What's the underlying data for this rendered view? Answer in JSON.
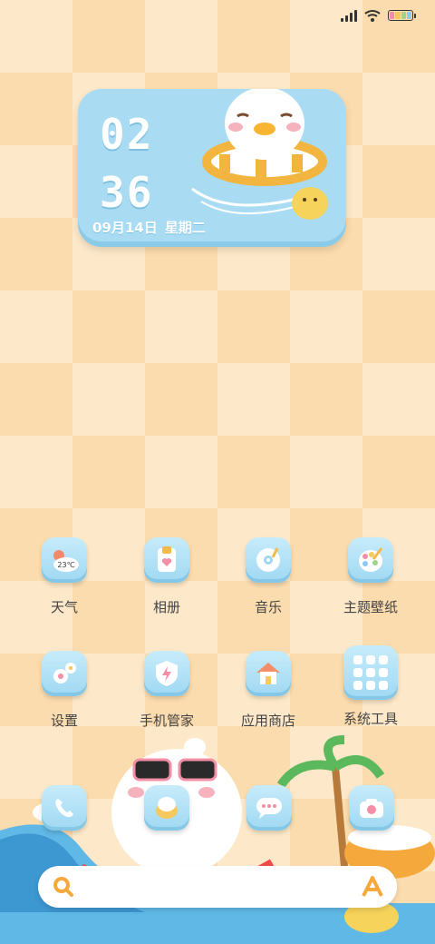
{
  "status_bar": {
    "signal_icon": "signal-icon",
    "wifi_icon": "wifi-icon",
    "battery_icon": "battery-icon"
  },
  "clock_widget": {
    "hour": "02",
    "minute": "36",
    "date": "09月14日",
    "weekday": "星期二",
    "color": "#a9dcf3"
  },
  "apps": [
    {
      "label": "天气",
      "icon": "weather-icon",
      "temp": "23℃"
    },
    {
      "label": "相册",
      "icon": "photo-album-icon"
    },
    {
      "label": "音乐",
      "icon": "music-disc-icon"
    },
    {
      "label": "主题壁纸",
      "icon": "theme-palette-icon"
    },
    {
      "label": "设置",
      "icon": "settings-gear-icon"
    },
    {
      "label": "手机管家",
      "icon": "phone-manager-shield-icon"
    },
    {
      "label": "应用商店",
      "icon": "app-store-house-icon"
    },
    {
      "label": "系统工具",
      "icon": "system-tools-folder-icon"
    }
  ],
  "dock": [
    {
      "icon": "phone-icon"
    },
    {
      "icon": "contacts-icon"
    },
    {
      "icon": "messages-icon"
    },
    {
      "icon": "camera-icon"
    }
  ],
  "search_bar": {
    "search_icon": "search-icon",
    "assistant_icon": "assistant-a-icon"
  }
}
